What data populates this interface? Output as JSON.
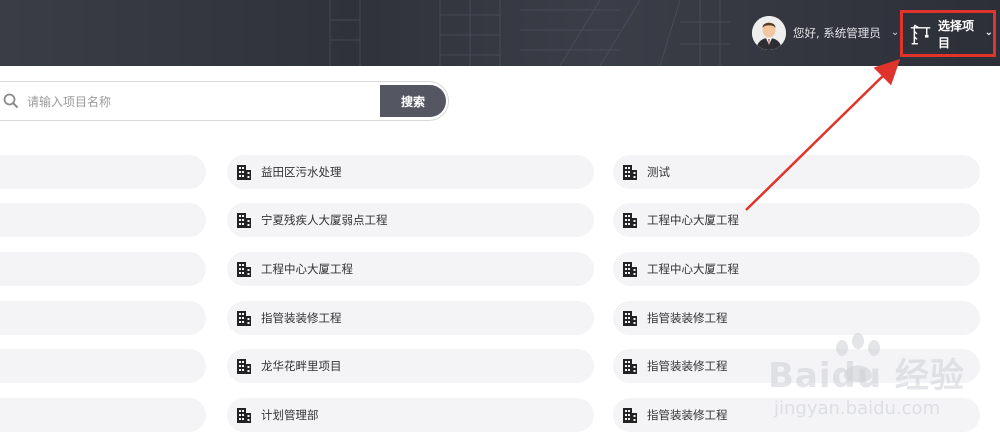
{
  "header": {
    "greeting": "您好, 系统管理员",
    "project_select_label": "选择项目"
  },
  "search": {
    "placeholder": "请输入项目名称",
    "button_label": "搜索"
  },
  "projects": {
    "col2": [
      "益田区污水处理",
      "宁夏残疾人大厦弱点工程",
      "工程中心大厦工程",
      "指管装装修工程",
      "龙华花畔里项目",
      "计划管理部"
    ],
    "col3": [
      "测试",
      "工程中心大厦工程",
      "工程中心大厦工程",
      "指管装装修工程",
      "指管装装修工程",
      "指管装装修工程"
    ]
  },
  "watermark": {
    "brand": "Baidu 经验",
    "url": "jingyan.baidu.com"
  },
  "colors": {
    "header_bg": "#33363f",
    "search_button": "#545661",
    "highlight_red": "#e0332c",
    "pill_bg": "#f4f4f6"
  }
}
